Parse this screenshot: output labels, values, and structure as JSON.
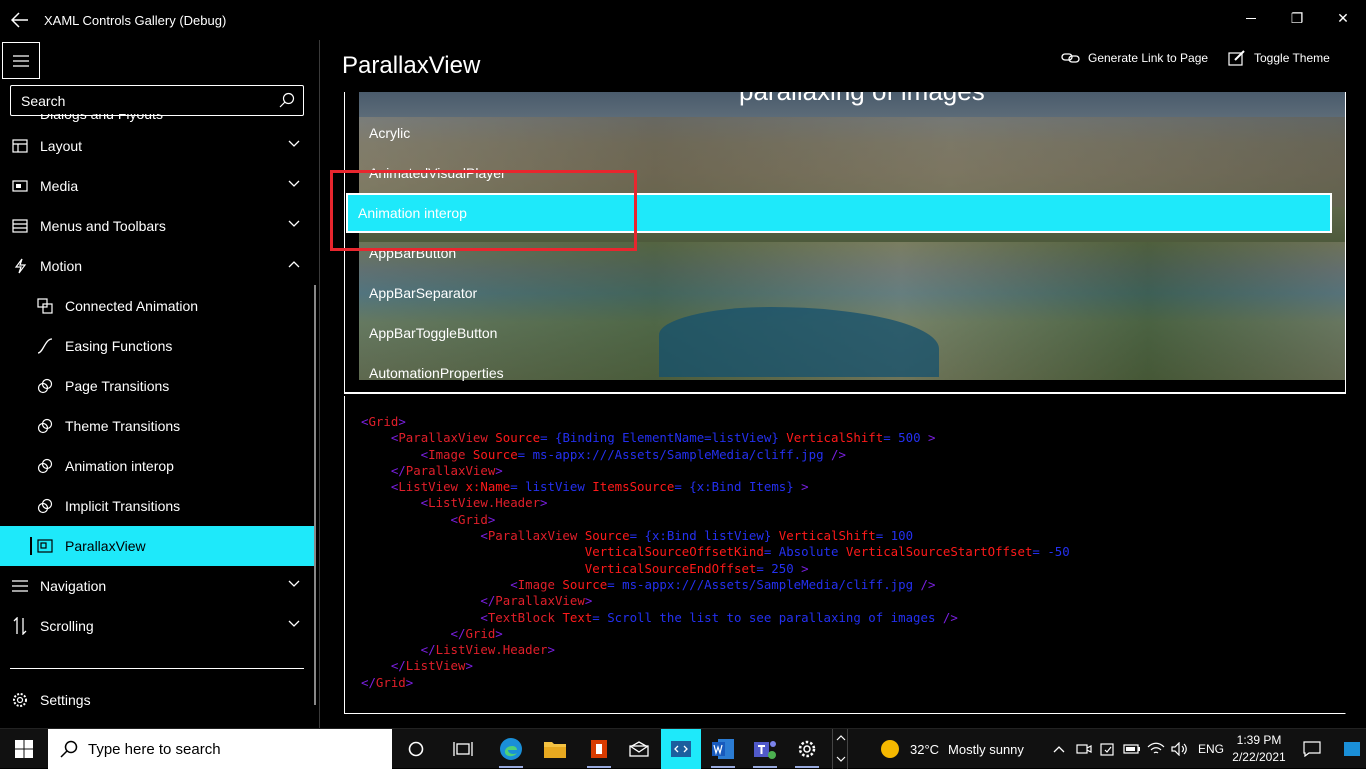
{
  "window": {
    "title": "XAML Controls Gallery (Debug)",
    "minimize_glyph": "—",
    "restore_glyph": "❐",
    "close_glyph": "✕"
  },
  "sidebar": {
    "search_placeholder": "Search",
    "partial_item": "Dialogs and Flyouts",
    "items": [
      {
        "label": "Layout",
        "icon": "layout-icon"
      },
      {
        "label": "Media",
        "icon": "media-icon"
      },
      {
        "label": "Menus and Toolbars",
        "icon": "menus-icon"
      },
      {
        "label": "Motion",
        "icon": "motion-icon"
      }
    ],
    "motion_items": [
      {
        "label": "Connected Animation"
      },
      {
        "label": "Easing Functions"
      },
      {
        "label": "Page Transitions"
      },
      {
        "label": "Theme Transitions"
      },
      {
        "label": "Animation interop"
      },
      {
        "label": "Implicit Transitions"
      },
      {
        "label": "ParallaxView"
      }
    ],
    "after_items": [
      {
        "label": "Navigation"
      },
      {
        "label": "Scrolling"
      }
    ],
    "settings_label": "Settings"
  },
  "page": {
    "title": "ParallaxView",
    "generate_link_label": "Generate Link to Page",
    "toggle_theme_label": "Toggle Theme"
  },
  "example": {
    "header_text": "parallaxing of images",
    "list_items": [
      "Acrylic",
      "AnimatedVisualPlayer",
      "Animation interop",
      "AppBarButton",
      "AppBarSeparator",
      "AppBarToggleButton",
      "AutomationProperties"
    ],
    "selected_index": 2
  },
  "code": {
    "lines": [
      [
        [
          "tg",
          "<"
        ],
        [
          "tn",
          "Grid"
        ],
        [
          "tg",
          ">"
        ]
      ],
      [
        [
          "tg",
          "    <"
        ],
        [
          "tn",
          "ParallaxView "
        ],
        [
          "at",
          "Source"
        ],
        [
          "vl",
          "= {Binding ElementName=listView} "
        ],
        [
          "at",
          "VerticalShift"
        ],
        [
          "vl",
          "= 500 "
        ],
        [
          "tg",
          ">"
        ]
      ],
      [
        [
          "tg",
          "        <"
        ],
        [
          "tn",
          "Image "
        ],
        [
          "at",
          "Source"
        ],
        [
          "vl",
          "= ms-appx:///Assets/SampleMedia/cliff.jpg "
        ],
        [
          "tg",
          "/>"
        ]
      ],
      [
        [
          "tg",
          "    </"
        ],
        [
          "tn",
          "ParallaxView"
        ],
        [
          "tg",
          ">"
        ]
      ],
      [
        [
          "tg",
          "    <"
        ],
        [
          "tn",
          "ListView "
        ],
        [
          "at",
          "x:Name"
        ],
        [
          "vl",
          "= listView "
        ],
        [
          "at",
          "ItemsSource"
        ],
        [
          "vl",
          "= {x:Bind Items} "
        ],
        [
          "tg",
          ">"
        ]
      ],
      [
        [
          "tg",
          "        <"
        ],
        [
          "tn",
          "ListView.Header"
        ],
        [
          "tg",
          ">"
        ]
      ],
      [
        [
          "tg",
          "            <"
        ],
        [
          "tn",
          "Grid"
        ],
        [
          "tg",
          ">"
        ]
      ],
      [
        [
          "tg",
          "                <"
        ],
        [
          "tn",
          "ParallaxView "
        ],
        [
          "at",
          "Source"
        ],
        [
          "vl",
          "= {x:Bind listView} "
        ],
        [
          "at",
          "VerticalShift"
        ],
        [
          "vl",
          "= 100"
        ]
      ],
      [
        [
          "at",
          "                              VerticalSourceOffsetKind"
        ],
        [
          "vl",
          "= Absolute "
        ],
        [
          "at",
          "VerticalSourceStartOffset"
        ],
        [
          "vl",
          "= -50"
        ]
      ],
      [
        [
          "at",
          "                              VerticalSourceEndOffset"
        ],
        [
          "vl",
          "= 250 "
        ],
        [
          "tg",
          ">"
        ]
      ],
      [
        [
          "tg",
          "                    <"
        ],
        [
          "tn",
          "Image "
        ],
        [
          "at",
          "Source"
        ],
        [
          "vl",
          "= ms-appx:///Assets/SampleMedia/cliff.jpg "
        ],
        [
          "tg",
          "/>"
        ]
      ],
      [
        [
          "tg",
          "                </"
        ],
        [
          "tn",
          "ParallaxView"
        ],
        [
          "tg",
          ">"
        ]
      ],
      [
        [
          "tg",
          "                <"
        ],
        [
          "tn",
          "TextBlock "
        ],
        [
          "at",
          "Text"
        ],
        [
          "vl",
          "= Scroll the list to see parallaxing of images "
        ],
        [
          "tg",
          "/>"
        ]
      ],
      [
        [
          "tg",
          "            </"
        ],
        [
          "tn",
          "Grid"
        ],
        [
          "tg",
          ">"
        ]
      ],
      [
        [
          "tg",
          "        </"
        ],
        [
          "tn",
          "ListView.Header"
        ],
        [
          "tg",
          ">"
        ]
      ],
      [
        [
          "tg",
          "    </"
        ],
        [
          "tn",
          "ListView"
        ],
        [
          "tg",
          ">"
        ]
      ],
      [
        [
          "tg",
          "</"
        ],
        [
          "tn",
          "Grid"
        ],
        [
          "tg",
          ">"
        ]
      ]
    ]
  },
  "taskbar": {
    "search_placeholder": "Type here to search",
    "weather_temp": "32°C",
    "weather_text": "Mostly sunny",
    "language": "ENG",
    "time": "1:39 PM",
    "date": "2/22/2021"
  },
  "colors": {
    "accent": "#1ee9fa",
    "highlight_box": "#e8262e",
    "code_tag": "#7a1fe0",
    "code_attr": "#ff1a1a",
    "code_value": "#2430f0"
  }
}
